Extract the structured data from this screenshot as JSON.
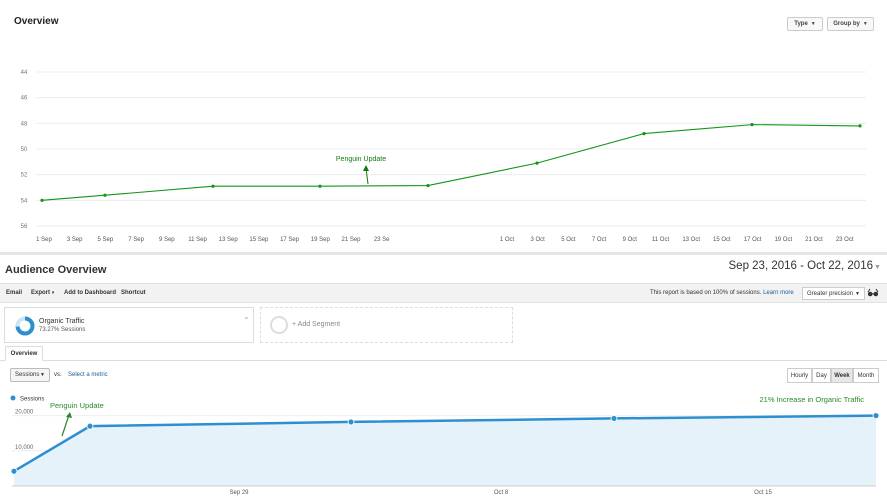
{
  "top_panel": {
    "title": "Overview",
    "type_button": "Type",
    "group_button": "Group by"
  },
  "top_chart": {
    "type": "line",
    "y_ticks": [
      "44",
      "46",
      "48",
      "50",
      "52",
      "54",
      "56"
    ],
    "y_inverted": true,
    "ylim": [
      44,
      56
    ],
    "x_ticks": [
      "1 Sep",
      "3 Sep",
      "5 Sep",
      "7 Sep",
      "9 Sep",
      "11 Sep",
      "13 Sep",
      "15 Sep",
      "17 Sep",
      "19 Sep",
      "21 Sep",
      "23 Se",
      "1 Oct",
      "3 Oct",
      "5 Oct",
      "7 Oct",
      "9 Oct",
      "11 Oct",
      "13 Oct",
      "15 Oct",
      "17 Oct",
      "19 Oct",
      "21 Oct",
      "23 Oct"
    ],
    "points": [
      54,
      53.6,
      52.9,
      52.9,
      52.85,
      51.1,
      48.8,
      48.1,
      48.2
    ],
    "point_dates": [
      "1 Sep",
      "5 Sep",
      "12 Sep",
      "19 Sep",
      "26 Sep",
      "3 Oct",
      "10 Oct",
      "17 Oct",
      "24 Oct"
    ],
    "annotation": "Penguin Update",
    "line_color": "#109618",
    "annotation_color": "#107a10"
  },
  "audience": {
    "title": "Audience Overview",
    "date_range": "Sep 23, 2016 - Oct 22, 2016",
    "toolbar": {
      "email": "Email",
      "export": "Export",
      "add_dashboard": "Add to Dashboard",
      "shortcut": "Shortcut",
      "report_note": "This report is based on 100% of sessions.",
      "learn_more": "Learn more",
      "precision": "Greater precision"
    },
    "segment": {
      "name": "Organic Traffic",
      "pct": "73.27% Sessions",
      "add_label": "+ Add Segment"
    },
    "tab": "Overview",
    "metric": "Sessions",
    "vs": "vs.",
    "select_metric": "Select a metric",
    "range_buttons": {
      "hourly": "Hourly",
      "day": "Day",
      "week": "Week",
      "month": "Month"
    }
  },
  "bottom_chart": {
    "type": "area",
    "legend": "Sessions",
    "y_ticks": [
      "20,000",
      "10,000"
    ],
    "ylim": [
      0,
      25000
    ],
    "x_ticks": [
      "Sep 29",
      "Oct 8",
      "Oct 15"
    ],
    "values": [
      4200,
      17000,
      18200,
      19200,
      20000
    ],
    "point_dates": [
      "Sep 23",
      "Sep 25",
      "Oct 2",
      "Oct 9",
      "Oct 16+"
    ],
    "annotations": {
      "penguin": "Penguin Update",
      "increase": "21% Increase in Organic Traffic"
    },
    "line_color": "#2e8fd0",
    "fill_color": "#e5f2fa",
    "annotation_color": "#2a8a2a"
  }
}
